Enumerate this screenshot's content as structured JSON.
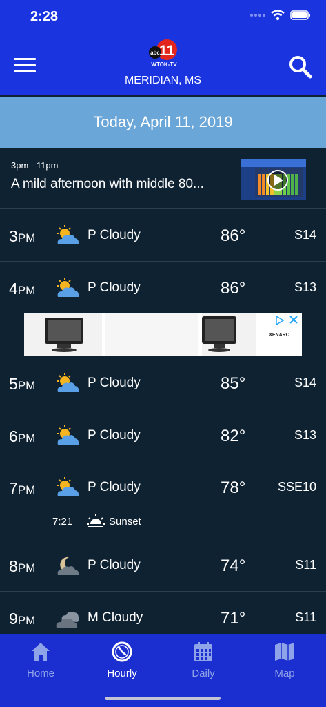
{
  "status": {
    "time": "2:28"
  },
  "header": {
    "logo_text": "11",
    "logo_network": "abc",
    "logo_sub": "WTOK-TV",
    "city": "MERIDIAN, MS"
  },
  "date_banner": "Today, April 11, 2019",
  "summary": {
    "time_range": "3pm - 11pm",
    "text": "A mild afternoon with middle 80..."
  },
  "hours": [
    {
      "hour": "3",
      "ampm": "PM",
      "icon": "partly-cloudy-icon",
      "condition": "P Cloudy",
      "temp": "86°",
      "wind": "S14"
    },
    {
      "hour": "4",
      "ampm": "PM",
      "icon": "partly-cloudy-icon",
      "condition": "P Cloudy",
      "temp": "86°",
      "wind": "S13"
    },
    {
      "hour": "5",
      "ampm": "PM",
      "icon": "partly-cloudy-icon",
      "condition": "P Cloudy",
      "temp": "85°",
      "wind": "S14"
    },
    {
      "hour": "6",
      "ampm": "PM",
      "icon": "partly-cloudy-icon",
      "condition": "P Cloudy",
      "temp": "82°",
      "wind": "S13"
    },
    {
      "hour": "7",
      "ampm": "PM",
      "icon": "partly-cloudy-icon",
      "condition": "P Cloudy",
      "temp": "78°",
      "wind": "SSE10",
      "sun_event": {
        "time": "7:21",
        "label": "Sunset"
      }
    },
    {
      "hour": "8",
      "ampm": "PM",
      "icon": "moon-cloudy-icon",
      "condition": "P Cloudy",
      "temp": "74°",
      "wind": "S11"
    },
    {
      "hour": "9",
      "ampm": "PM",
      "icon": "mostly-cloudy-icon",
      "condition": "M Cloudy",
      "temp": "71°",
      "wind": "S11"
    }
  ],
  "ad": {
    "brand": "XENARC"
  },
  "tabs": [
    {
      "label": "Home",
      "icon": "home-icon",
      "active": false
    },
    {
      "label": "Hourly",
      "icon": "clock-icon",
      "active": true
    },
    {
      "label": "Daily",
      "icon": "calendar-icon",
      "active": false
    },
    {
      "label": "Map",
      "icon": "map-icon",
      "active": false
    }
  ],
  "colors": {
    "header": "#1a35e0",
    "banner": "#6aa6d8",
    "background": "#0f2232",
    "tabbar": "#1b2ed0",
    "tab_inactive": "#8fa3e8"
  }
}
